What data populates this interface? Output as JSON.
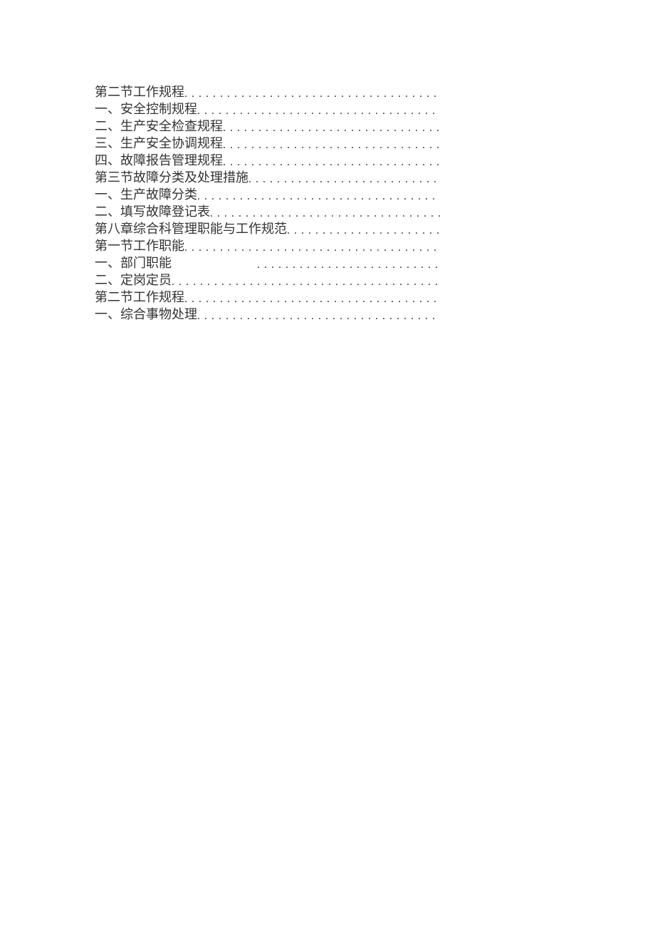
{
  "toc": {
    "entries": [
      {
        "text": "第二节工作规程",
        "has_gap": false
      },
      {
        "text": "一、安全控制规程",
        "has_gap": false
      },
      {
        "text": "二、生产安全检查规程",
        "has_gap": false
      },
      {
        "text": "三、生产安全协调规程",
        "has_gap": false
      },
      {
        "text": "四、故障报告管理规程",
        "has_gap": false
      },
      {
        "text": "第三节故障分类及处理措施",
        "has_gap": false
      },
      {
        "text": "一、生产故障分类",
        "has_gap": false
      },
      {
        "text": "二、填写故障登记表",
        "has_gap": false
      },
      {
        "text": "第八章综合科管理职能与工作规范",
        "has_gap": false
      },
      {
        "text": "第一节工作职能",
        "has_gap": false
      },
      {
        "text": "一、部门职能",
        "has_gap": true
      },
      {
        "text": "二、定岗定员",
        "has_gap": false
      },
      {
        "text": "第二节工作规程",
        "has_gap": false
      },
      {
        "text": "一、综合事物处理",
        "has_gap": false
      }
    ]
  }
}
